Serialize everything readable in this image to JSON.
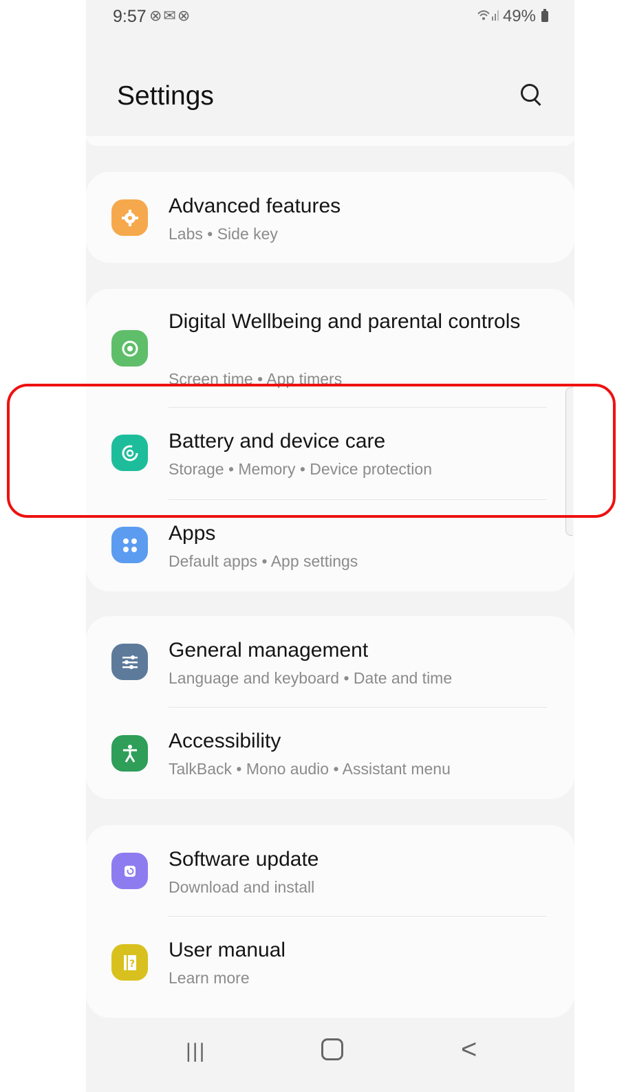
{
  "status_bar": {
    "time": "9:57",
    "notification_icons": "⊗✉⊗",
    "battery": "49%"
  },
  "header": {
    "title": "Settings",
    "search_icon": "search-icon"
  },
  "sections": [
    {
      "items": [
        {
          "label": "Advanced features",
          "sub": "Labs  •  Side key",
          "icon": "gear-icon",
          "icon_color": "#f5a94c"
        }
      ]
    },
    {
      "items": [
        {
          "label": "Digital Wellbeing and parental controls",
          "sub": "Screen time  •  App timers",
          "icon": "wellbeing-icon",
          "icon_color": "#5fbe6a"
        },
        {
          "label": "Battery and device care",
          "sub": "Storage  •  Memory  •  Device protection",
          "icon": "device-care-icon",
          "icon_color": "#1dbd9b"
        },
        {
          "label": "Apps",
          "sub": "Default apps  •  App settings",
          "icon": "apps-icon",
          "icon_color": "#5b9cf0"
        }
      ]
    },
    {
      "items": [
        {
          "label": "General management",
          "sub": "Language and keyboard  •  Date and time",
          "icon": "sliders-icon",
          "icon_color": "#5d7a9b"
        },
        {
          "label": "Accessibility",
          "sub": "TalkBack  •  Mono audio  •  Assistant menu",
          "icon": "accessibility-icon",
          "icon_color": "#2e9e59"
        }
      ]
    },
    {
      "items": [
        {
          "label": "Software update",
          "sub": "Download and install",
          "icon": "update-icon",
          "icon_color": "#8d7cf0"
        },
        {
          "label": "User manual",
          "sub": "Learn more",
          "icon": "manual-icon",
          "icon_color": "#d8c11e"
        }
      ]
    }
  ],
  "highlight": {
    "target": "Battery and device care",
    "color": "#ee1111"
  },
  "nav_bar": {
    "recents": "|||",
    "back": "<"
  }
}
